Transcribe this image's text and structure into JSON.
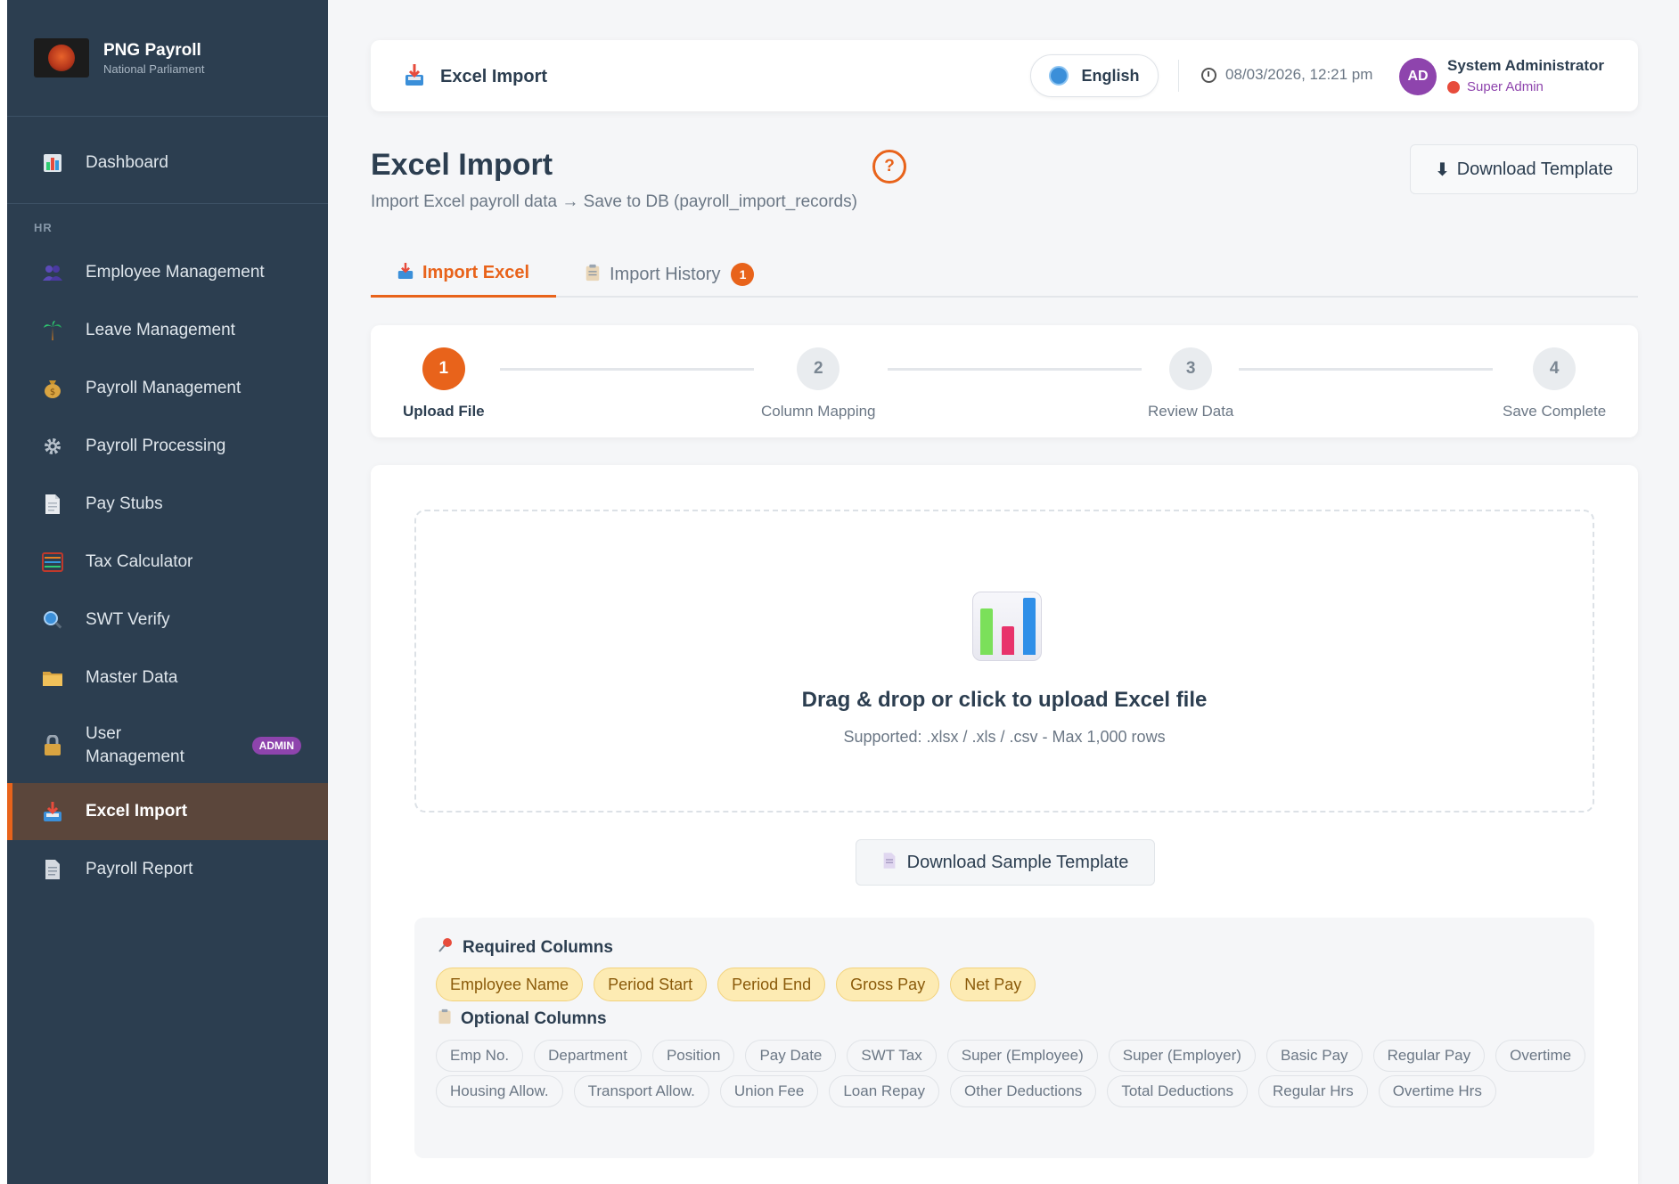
{
  "sidebar": {
    "brand_name": "PNG Payroll",
    "brand_sub": "National Parliament",
    "section_hr": "HR",
    "items": [
      {
        "label": "Dashboard",
        "icon": "chart-icon"
      },
      {
        "label": "Employee Management",
        "icon": "users-icon"
      },
      {
        "label": "Leave Management",
        "icon": "palm-tree-icon"
      },
      {
        "label": "Payroll Management",
        "icon": "money-bag-icon"
      },
      {
        "label": "Payroll Processing",
        "icon": "gear-icon"
      },
      {
        "label": "Pay Stubs",
        "icon": "document-icon"
      },
      {
        "label": "Tax Calculator",
        "icon": "abacus-icon"
      },
      {
        "label": "SWT Verify",
        "icon": "magnifier-icon"
      },
      {
        "label": "Master Data",
        "icon": "folder-icon"
      },
      {
        "label": "User Management",
        "icon": "lock-icon",
        "badge": "ADMIN"
      },
      {
        "label": "Excel Import",
        "icon": "inbox-tray-icon",
        "active": true
      },
      {
        "label": "Payroll Report",
        "icon": "report-icon"
      }
    ]
  },
  "topbar": {
    "title": "Excel Import",
    "language": "English",
    "datetime": "08/03/2026, 12:21 pm",
    "avatar_initials": "AD",
    "user_name": "System Administrator",
    "user_role": "Super Admin"
  },
  "page": {
    "title": "Excel Import",
    "help": "?",
    "subtitle": "Import Excel payroll data → Save to DB (payroll_import_records)",
    "download_template": "Download Template"
  },
  "tabs": [
    {
      "label": "Import Excel",
      "active": true
    },
    {
      "label": "Import History",
      "badge": "1"
    }
  ],
  "stepper": [
    {
      "num": "1",
      "label": "Upload File",
      "active": true
    },
    {
      "num": "2",
      "label": "Column Mapping"
    },
    {
      "num": "3",
      "label": "Review Data"
    },
    {
      "num": "4",
      "label": "Save Complete"
    }
  ],
  "upload": {
    "title": "Drag & drop or click to upload Excel file",
    "subtitle": "Supported: .xlsx / .xls / .csv - Max 1,000 rows",
    "sample_button": "Download Sample Template"
  },
  "columns": {
    "required_title": "Required Columns",
    "required": [
      "Employee Name",
      "Period Start",
      "Period End",
      "Gross Pay",
      "Net Pay"
    ],
    "optional_title": "Optional Columns",
    "optional_row1": [
      "Emp No.",
      "Department",
      "Position",
      "Pay Date",
      "SWT Tax",
      "Super (Employee)",
      "Super (Employer)",
      "Basic Pay",
      "Regular Pay",
      "Overtime"
    ],
    "optional_row2": [
      "Housing Allow.",
      "Transport Allow.",
      "Union Fee",
      "Loan Repay",
      "Other Deductions",
      "Total Deductions",
      "Regular Hrs",
      "Overtime Hrs"
    ]
  },
  "colors": {
    "accent": "#e8631b",
    "sidebar_bg": "#2c3e50",
    "admin_badge": "#8e44ad",
    "required_chip": "#fdebb3"
  }
}
